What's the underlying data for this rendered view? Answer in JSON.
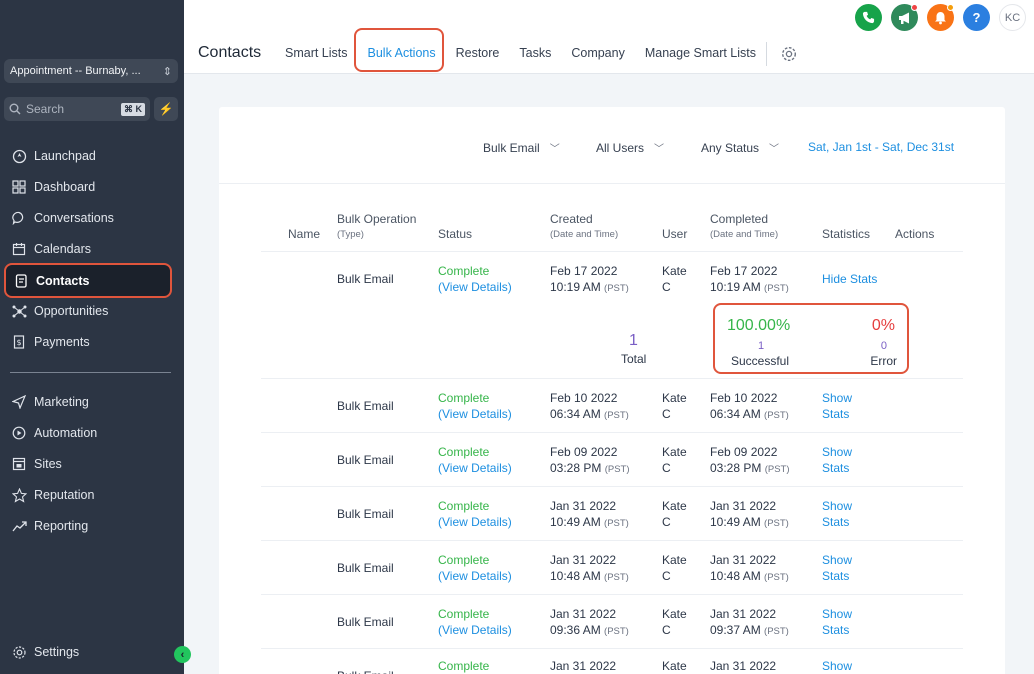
{
  "sidebar": {
    "location": "Appointment -- Burnaby, ...",
    "search_label": "Search",
    "search_shortcut": "⌘ K",
    "items": [
      {
        "label": "Launchpad",
        "icon": "rocket-icon"
      },
      {
        "label": "Dashboard",
        "icon": "dashboard-icon"
      },
      {
        "label": "Conversations",
        "icon": "chat-icon"
      },
      {
        "label": "Calendars",
        "icon": "calendar-icon"
      },
      {
        "label": "Contacts",
        "icon": "contacts-icon",
        "active": true
      },
      {
        "label": "Opportunities",
        "icon": "opportunities-icon"
      },
      {
        "label": "Payments",
        "icon": "payments-icon"
      }
    ],
    "items2": [
      {
        "label": "Marketing",
        "icon": "send-icon"
      },
      {
        "label": "Automation",
        "icon": "automation-icon"
      },
      {
        "label": "Sites",
        "icon": "sites-icon"
      },
      {
        "label": "Reputation",
        "icon": "star-icon"
      },
      {
        "label": "Reporting",
        "icon": "chart-icon"
      }
    ],
    "settings_label": "Settings"
  },
  "header": {
    "title": "Contacts",
    "tabs": [
      "Smart Lists",
      "Bulk Actions",
      "Restore",
      "Tasks",
      "Company",
      "Manage Smart Lists"
    ],
    "active_tab": "Bulk Actions",
    "avatar_initials": "KC",
    "help_glyph": "?"
  },
  "filters": {
    "type": "Bulk Email",
    "users": "All Users",
    "status": "Any Status",
    "date_range": "Sat, Jan 1st - Sat, Dec 31st"
  },
  "table": {
    "headers": {
      "name": "Name",
      "bulk_operation": "Bulk Operation",
      "bulk_operation_sub": "(Type)",
      "status": "Status",
      "created": "Created",
      "created_sub": "(Date and Time)",
      "user": "User",
      "completed": "Completed",
      "completed_sub": "(Date and Time)",
      "statistics": "Statistics",
      "actions": "Actions"
    },
    "tz": "(PST)",
    "view_details": "(View Details)",
    "rows": [
      {
        "type": "Bulk Email",
        "status": "Complete",
        "created_date": "Feb 17 2022",
        "created_time": "10:19 AM",
        "user1": "Kate",
        "user2": "C",
        "completed_date": "Feb 17 2022",
        "completed_time": "10:19 AM",
        "stats1": "Hide Stats",
        "stats2": ""
      },
      {
        "type": "Bulk Email",
        "status": "Complete",
        "created_date": "Feb 10 2022",
        "created_time": "06:34 AM",
        "user1": "Kate",
        "user2": "C",
        "completed_date": "Feb 10 2022",
        "completed_time": "06:34 AM",
        "stats1": "Show",
        "stats2": "Stats"
      },
      {
        "type": "Bulk Email",
        "status": "Complete",
        "created_date": "Feb 09 2022",
        "created_time": "03:28 PM",
        "user1": "Kate",
        "user2": "C",
        "completed_date": "Feb 09 2022",
        "completed_time": "03:28 PM",
        "stats1": "Show",
        "stats2": "Stats"
      },
      {
        "type": "Bulk Email",
        "status": "Complete",
        "created_date": "Jan 31 2022",
        "created_time": "10:49 AM",
        "user1": "Kate",
        "user2": "C",
        "completed_date": "Jan 31 2022",
        "completed_time": "10:49 AM",
        "stats1": "Show",
        "stats2": "Stats"
      },
      {
        "type": "Bulk Email",
        "status": "Complete",
        "created_date": "Jan 31 2022",
        "created_time": "10:48 AM",
        "user1": "Kate",
        "user2": "C",
        "completed_date": "Jan 31 2022",
        "completed_time": "10:48 AM",
        "stats1": "Show",
        "stats2": "Stats"
      },
      {
        "type": "Bulk Email",
        "status": "Complete",
        "created_date": "Jan 31 2022",
        "created_time": "09:36 AM",
        "user1": "Kate",
        "user2": "C",
        "completed_date": "Jan 31 2022",
        "completed_time": "09:37 AM",
        "stats1": "Show",
        "stats2": "Stats"
      },
      {
        "type": "Bulk Email",
        "status": "Complete",
        "created_date": "Jan 31 2022",
        "created_time": "",
        "user1": "Kate",
        "user2": "",
        "completed_date": "Jan 31 2022",
        "completed_time": "",
        "stats1": "Show",
        "stats2": ""
      }
    ]
  },
  "stats": {
    "total_value": "1",
    "total_label": "Total",
    "success_pct": "100.00%",
    "success_count": "1",
    "success_label": "Successful",
    "error_pct": "0%",
    "error_count": "0",
    "error_label": "Error"
  },
  "colors": {
    "sidebar_bg": "#2c3544",
    "accent_blue": "#1d8fe0",
    "success_green": "#36b54a",
    "error_red": "#e53e3e",
    "highlight": "#e0553c"
  }
}
